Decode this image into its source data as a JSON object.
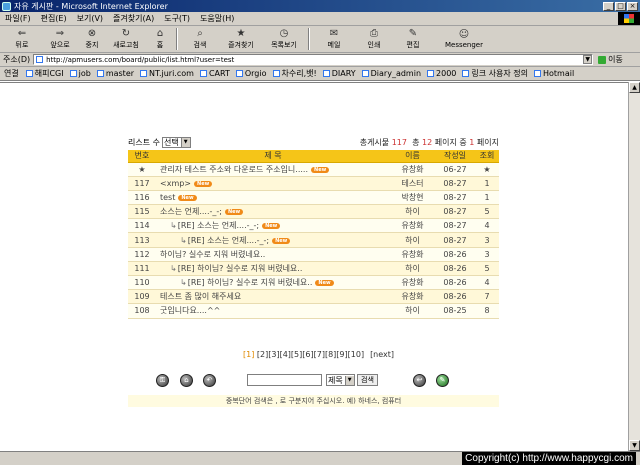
{
  "window": {
    "title": "자유 게시판 - Microsoft Internet Explorer",
    "btn_min": "_",
    "btn_max": "□",
    "btn_close": "×"
  },
  "menu": [
    "파일(F)",
    "편집(E)",
    "보기(V)",
    "즐겨찾기(A)",
    "도구(T)",
    "도움말(H)"
  ],
  "toolbar": [
    {
      "label": "뒤로",
      "icon": "back-arrow-icon",
      "glyph": "⇐"
    },
    {
      "label": "앞으로",
      "icon": "forward-arrow-icon",
      "glyph": "⇒"
    },
    {
      "label": "중지",
      "icon": "stop-icon",
      "glyph": "⊗"
    },
    {
      "label": "새로고침",
      "icon": "refresh-icon",
      "glyph": "↻"
    },
    {
      "label": "홈",
      "icon": "home-icon",
      "glyph": "⌂"
    },
    {
      "label": "검색",
      "icon": "search-icon",
      "glyph": "⌕"
    },
    {
      "label": "즐겨찾기",
      "icon": "favorites-icon",
      "glyph": "★"
    },
    {
      "label": "목록보기",
      "icon": "history-icon",
      "glyph": "◷"
    },
    {
      "label": "메일",
      "icon": "mail-icon",
      "glyph": "✉"
    },
    {
      "label": "인쇄",
      "icon": "print-icon",
      "glyph": "⎙"
    },
    {
      "label": "편집",
      "icon": "edit-icon",
      "glyph": "✎"
    },
    {
      "label": "Messenger",
      "icon": "messenger-icon",
      "glyph": "☺"
    }
  ],
  "address": {
    "label": "주소(D)",
    "url": "http://apmusers.com/board/public/list.html?user=test",
    "go_label": "이동"
  },
  "links": {
    "label": "연결",
    "items": [
      "해피CGI",
      "job",
      "master",
      "NT.juri.com",
      "CART",
      "Orgio",
      "차수리,뱃!",
      "DIARY",
      "Diary_admin",
      "2000",
      "링크 사용자 정의",
      "Hotmail"
    ]
  },
  "board": {
    "list_count_label": "리스트 수",
    "list_count_value": "선택",
    "total_label": "총게시물",
    "total_count": "117",
    "total_pages_prefix": "총",
    "total_pages": "12",
    "pages_mid": "페이지 중",
    "current_page": "1",
    "pages_suffix": "페이지",
    "headers": {
      "no": "번호",
      "subject": "제 목",
      "name": "이름",
      "date": "작성일",
      "views": "조회"
    },
    "new_badge": "New",
    "rows": [
      {
        "no": "★",
        "subject": "관리자 테스트 주소와 다운로드 주소입니.....",
        "depth": 0,
        "is_new": true,
        "name": "유창화",
        "date": "06-27",
        "views": "★"
      },
      {
        "no": "117",
        "subject": "<xmp>",
        "depth": 0,
        "is_new": true,
        "name": "테스터",
        "date": "08-27",
        "views": "1"
      },
      {
        "no": "116",
        "subject": "test",
        "depth": 0,
        "is_new": true,
        "name": "박창현",
        "date": "08-27",
        "views": "1"
      },
      {
        "no": "115",
        "subject": "소스는 언제....-_-;",
        "depth": 0,
        "is_new": true,
        "name": "하이",
        "date": "08-27",
        "views": "5"
      },
      {
        "no": "114",
        "subject": "[RE] 소스는 언제....-_-;",
        "depth": 1,
        "is_new": true,
        "name": "유창화",
        "date": "08-27",
        "views": "4"
      },
      {
        "no": "113",
        "subject": "[RE] 소스는 언제....-_-;",
        "depth": 2,
        "is_new": true,
        "name": "하이",
        "date": "08-27",
        "views": "3"
      },
      {
        "no": "112",
        "subject": "하이님? 실수로 지워 버렸네요..",
        "depth": 0,
        "is_new": false,
        "name": "유창화",
        "date": "08-26",
        "views": "3"
      },
      {
        "no": "111",
        "subject": "[RE] 하이님? 실수로 지워 버렸네요..",
        "depth": 1,
        "is_new": false,
        "name": "하이",
        "date": "08-26",
        "views": "5"
      },
      {
        "no": "110",
        "subject": "[RE] 하이님? 실수로 지워 버렸네요..",
        "depth": 2,
        "is_new": true,
        "name": "유창화",
        "date": "08-26",
        "views": "4"
      },
      {
        "no": "109",
        "subject": "테스트 좀 많이 해주세요",
        "depth": 0,
        "is_new": false,
        "name": "유창화",
        "date": "08-26",
        "views": "7"
      },
      {
        "no": "108",
        "subject": "굿입니다요....^^",
        "depth": 0,
        "is_new": false,
        "name": "하이",
        "date": "08-25",
        "views": "8"
      }
    ],
    "paging": {
      "current": "[1]",
      "pages": [
        "[2]",
        "[3]",
        "[4]",
        "[5]",
        "[6]",
        "[7]",
        "[8]",
        "[9]",
        "[10]"
      ],
      "next": "[next]"
    },
    "search": {
      "field_value": "제목",
      "button_label": "검색"
    },
    "help_text": "중복단어 검색은 , 로 구분지어 주십시오. 예) 하네스, 컴퓨터"
  },
  "copyright": "Copyright(c) http://www.happycgi.com"
}
